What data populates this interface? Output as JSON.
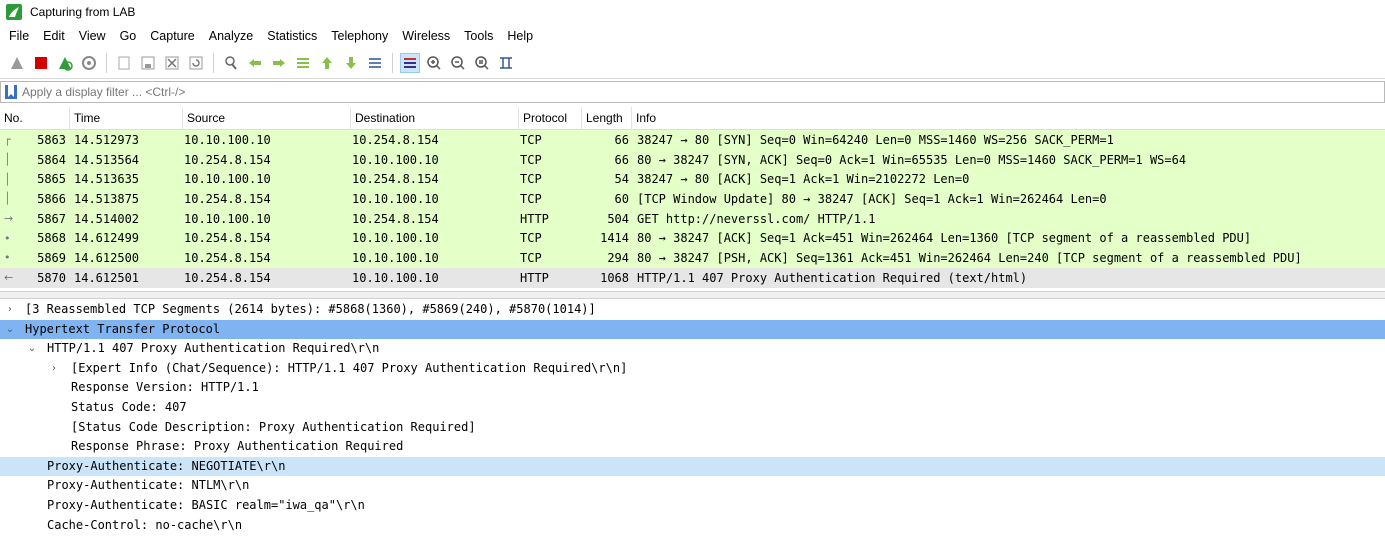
{
  "window": {
    "title": "Capturing from LAB",
    "app_icon": "wireshark-fin-icon"
  },
  "menu": [
    "File",
    "Edit",
    "View",
    "Go",
    "Capture",
    "Analyze",
    "Statistics",
    "Telephony",
    "Wireless",
    "Tools",
    "Help"
  ],
  "toolbar": {
    "icons": [
      "start-capture-icon",
      "stop-capture-icon",
      "restart-capture-icon",
      "capture-options-icon",
      "open-file-icon",
      "save-file-icon",
      "close-file-icon",
      "reload-file-icon",
      "find-packet-icon",
      "go-back-icon",
      "go-forward-icon",
      "go-to-packet-icon",
      "go-first-packet-icon",
      "go-last-packet-icon",
      "auto-scroll-icon",
      "colorize-icon",
      "zoom-in-icon",
      "zoom-out-icon",
      "normal-size-icon",
      "resize-columns-icon"
    ]
  },
  "filter": {
    "placeholder": "Apply a display filter ... <Ctrl-/>",
    "value": ""
  },
  "packet_list": {
    "columns": [
      "No.",
      "Time",
      "Source",
      "Destination",
      "Protocol",
      "Length",
      "Info"
    ],
    "rows": [
      {
        "no": "5863",
        "time": "14.512973",
        "src": "10.10.100.10",
        "dst": "10.254.8.154",
        "proto": "TCP",
        "len": "66",
        "info": "38247 → 80 [SYN] Seq=0 Win=64240 Len=0 MSS=1460 WS=256 SACK_PERM=1"
      },
      {
        "no": "5864",
        "time": "14.513564",
        "src": "10.254.8.154",
        "dst": "10.10.100.10",
        "proto": "TCP",
        "len": "66",
        "info": "80 → 38247 [SYN, ACK] Seq=0 Ack=1 Win=65535 Len=0 MSS=1460 SACK_PERM=1 WS=64"
      },
      {
        "no": "5865",
        "time": "14.513635",
        "src": "10.10.100.10",
        "dst": "10.254.8.154",
        "proto": "TCP",
        "len": "54",
        "info": "38247 → 80 [ACK] Seq=1 Ack=1 Win=2102272 Len=0"
      },
      {
        "no": "5866",
        "time": "14.513875",
        "src": "10.254.8.154",
        "dst": "10.10.100.10",
        "proto": "TCP",
        "len": "60",
        "info": "[TCP Window Update] 80 → 38247 [ACK] Seq=1 Ack=1 Win=262464 Len=0"
      },
      {
        "no": "5867",
        "time": "14.514002",
        "src": "10.10.100.10",
        "dst": "10.254.8.154",
        "proto": "HTTP",
        "len": "504",
        "info": "GET http://neverssl.com/ HTTP/1.1"
      },
      {
        "no": "5868",
        "time": "14.612499",
        "src": "10.254.8.154",
        "dst": "10.10.100.10",
        "proto": "TCP",
        "len": "1414",
        "info": "80 → 38247 [ACK] Seq=1 Ack=451 Win=262464 Len=1360 [TCP segment of a reassembled PDU]"
      },
      {
        "no": "5869",
        "time": "14.612500",
        "src": "10.254.8.154",
        "dst": "10.10.100.10",
        "proto": "TCP",
        "len": "294",
        "info": "80 → 38247 [PSH, ACK] Seq=1361 Ack=451 Win=262464 Len=240 [TCP segment of a reassembled PDU]"
      },
      {
        "no": "5870",
        "time": "14.612501",
        "src": "10.254.8.154",
        "dst": "10.10.100.10",
        "proto": "HTTP",
        "len": "1068",
        "info": "HTTP/1.1 407 Proxy Authentication Required  (text/html)"
      }
    ],
    "row_color": "#e4ffc7",
    "selected_row_color": "#e6e6e6"
  },
  "details": {
    "rows": [
      {
        "text": "[3 Reassembled TCP Segments (2614 bytes): #5868(1360), #5869(240), #5870(1014)]",
        "expander": "›"
      },
      {
        "text": "Hypertext Transfer Protocol",
        "expander": "⌄"
      },
      {
        "text": "HTTP/1.1 407 Proxy Authentication Required\\r\\n",
        "expander": "⌄"
      },
      {
        "text": "[Expert Info (Chat/Sequence): HTTP/1.1 407 Proxy Authentication Required\\r\\n]",
        "expander": "›"
      },
      {
        "text": "Response Version: HTTP/1.1",
        "expander": ""
      },
      {
        "text": "Status Code: 407",
        "expander": ""
      },
      {
        "text": "[Status Code Description: Proxy Authentication Required]",
        "expander": ""
      },
      {
        "text": "Response Phrase: Proxy Authentication Required",
        "expander": ""
      },
      {
        "text": "Proxy-Authenticate: NEGOTIATE\\r\\n",
        "expander": ""
      },
      {
        "text": "Proxy-Authenticate: NTLM\\r\\n",
        "expander": ""
      },
      {
        "text": "Proxy-Authenticate: BASIC realm=\"iwa_qa\"\\r\\n",
        "expander": ""
      },
      {
        "text": "Cache-Control: no-cache\\r\\n",
        "expander": ""
      }
    ],
    "highlight_strong": "#7fb3f2",
    "highlight_light": "#cce4f7"
  }
}
